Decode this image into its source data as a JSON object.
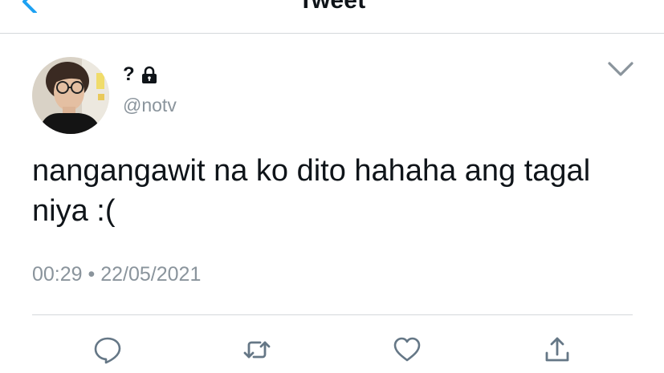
{
  "header": {
    "title": "Tweet",
    "back_icon": "chevron-left-icon"
  },
  "author": {
    "display_name": "?",
    "handle": "@notv",
    "protected_icon": "lock-icon"
  },
  "tweet": {
    "text": "nangangawit na ko dito hahaha ang tagal niya :(",
    "time": "00:29",
    "separator": "•",
    "date": "22/05/2021"
  },
  "actions": [
    {
      "name": "reply",
      "icon": "reply-bubble-icon"
    },
    {
      "name": "retweet",
      "icon": "retweet-icon"
    },
    {
      "name": "like",
      "icon": "heart-icon"
    },
    {
      "name": "share",
      "icon": "share-icon"
    }
  ],
  "colors": {
    "accent": "#1da1f2",
    "text": "#0f1419",
    "secondary": "#8a949c",
    "divider": "#d4d8db"
  }
}
